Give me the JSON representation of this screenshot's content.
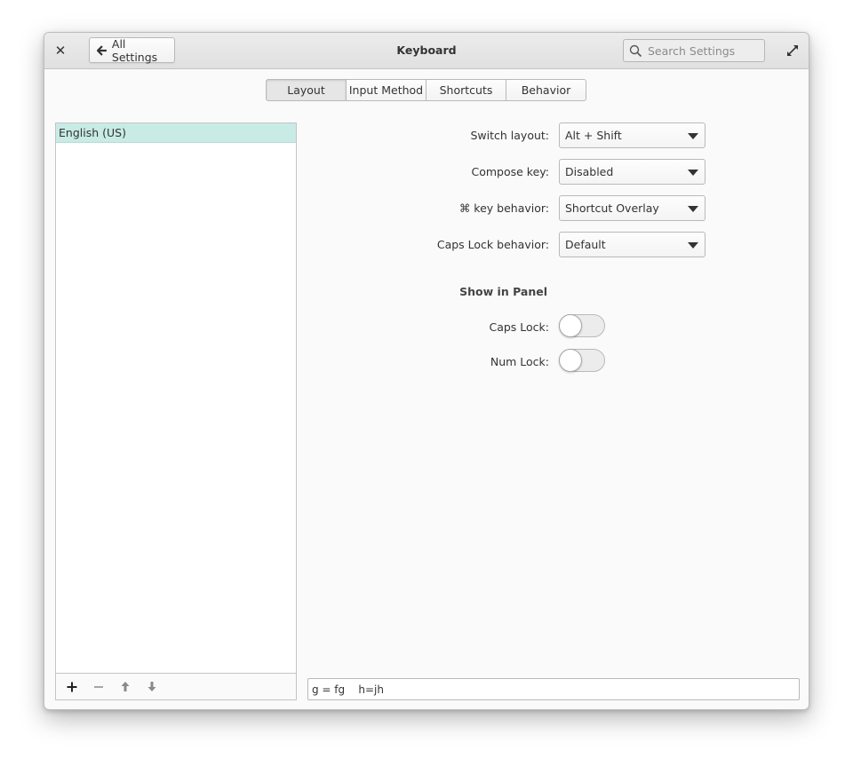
{
  "window": {
    "title": "Keyboard",
    "back_button_label": "All Settings",
    "search_placeholder": "Search Settings"
  },
  "tabs": [
    {
      "label": "Layout",
      "active": true
    },
    {
      "label": "Input Method",
      "active": false
    },
    {
      "label": "Shortcuts",
      "active": false
    },
    {
      "label": "Behavior",
      "active": false
    }
  ],
  "layouts": [
    {
      "label": "English (US)",
      "selected": true
    }
  ],
  "list_toolbar": {
    "add_icon": "plus-icon",
    "remove_icon": "minus-icon",
    "move_up_icon": "arrow-up-icon",
    "move_down_icon": "arrow-down-icon"
  },
  "settings": {
    "switch_layout": {
      "label": "Switch layout:",
      "value": "Alt + Shift"
    },
    "compose_key": {
      "label": "Compose key:",
      "value": "Disabled"
    },
    "cmd_key_behavior": {
      "label": "⌘ key behavior:",
      "value": "Shortcut Overlay"
    },
    "caps_lock_behavior": {
      "label": "Caps Lock behavior:",
      "value": "Default"
    }
  },
  "panel": {
    "heading": "Show in Panel",
    "caps_lock": {
      "label": "Caps Lock:",
      "on": false
    },
    "num_lock": {
      "label": "Num Lock:",
      "on": false
    }
  },
  "test_entry": {
    "value": "g = fg    h=jh"
  },
  "colors": {
    "selection": "#c8ebe5",
    "window_bg": "#fafafa"
  }
}
